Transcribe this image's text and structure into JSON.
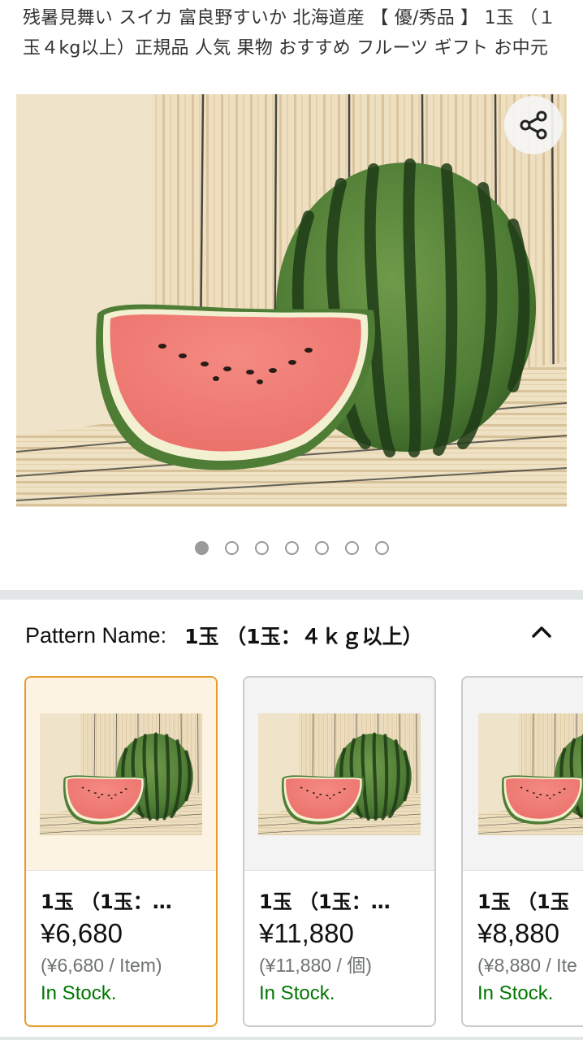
{
  "product": {
    "title": "残暑見舞い スイカ 富良野すいか 北海道産 【 優/秀品 】 1玉 （１玉４kg以上）正規品 人気 果物 おすすめ フルーツ ギフト お中元",
    "image_count": 7,
    "active_image_index": 0
  },
  "share": {
    "icon": "share-icon"
  },
  "pattern": {
    "label": "Pattern Name:",
    "value": "1玉 （1玉：４ｋｇ以上）",
    "toggle_icon": "chevron-up-icon"
  },
  "variants": [
    {
      "name": "1玉 （1玉：…",
      "price": "¥6,680",
      "unit_price": "(¥6,680 / Item)",
      "stock": "In Stock.",
      "selected": true
    },
    {
      "name": "1玉 （1玉：…",
      "price": "¥11,880",
      "unit_price": "(¥11,880 / 個)",
      "stock": "In Stock.",
      "selected": false
    },
    {
      "name": "1玉 （1玉",
      "price": "¥8,880",
      "unit_price": "(¥8,880 / Ite",
      "stock": "In Stock.",
      "selected": false
    }
  ],
  "colors": {
    "selected_border": "#e89a29",
    "in_stock": "#007600",
    "divider": "#e3e6e6"
  }
}
